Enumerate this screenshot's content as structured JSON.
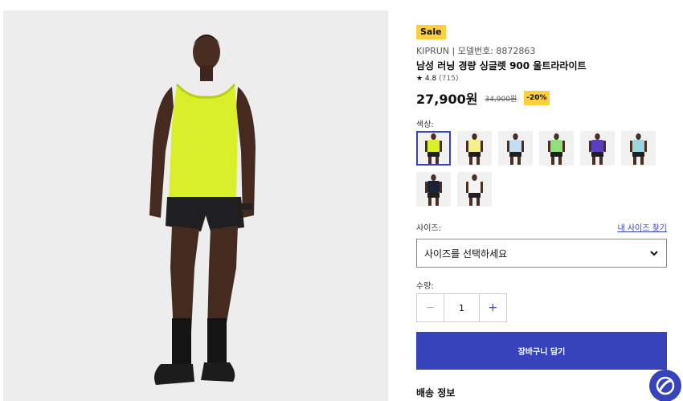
{
  "product": {
    "sale_badge": "Sale",
    "brand_line": "KIPRUN | 모델번호: 8872863",
    "title": "남성 러닝 경량 싱글렛 900 울트라라이트",
    "rating": "★ 4.8",
    "review_count": "(715)",
    "price": "27,900원",
    "old_price": "34,900원",
    "discount": "-20%"
  },
  "colors": {
    "label": "색상:",
    "swatches": [
      {
        "name": "lime",
        "shirt": "#d9ef2a",
        "selected": true
      },
      {
        "name": "pale-yellow",
        "shirt": "#f2f28a",
        "selected": false
      },
      {
        "name": "light-blue",
        "shirt": "#c6dcf0",
        "selected": false
      },
      {
        "name": "green",
        "shirt": "#8fe07a",
        "selected": false
      },
      {
        "name": "purple",
        "shirt": "#5a3fc0",
        "selected": false
      },
      {
        "name": "aqua",
        "shirt": "#9ad6df",
        "selected": false
      },
      {
        "name": "navy",
        "shirt": "#1b2238",
        "selected": false
      },
      {
        "name": "white",
        "shirt": "#f4f4f4",
        "selected": false
      }
    ]
  },
  "size": {
    "label": "사이즈:",
    "guide_link": "내 사이즈 찾기",
    "select_text": "사이즈를 선택하세요"
  },
  "quantity": {
    "label": "수량:",
    "value": "1",
    "minus": "−",
    "plus": "+"
  },
  "cart_button": "장바구니 담기",
  "shipping_title": "배송 정보"
}
